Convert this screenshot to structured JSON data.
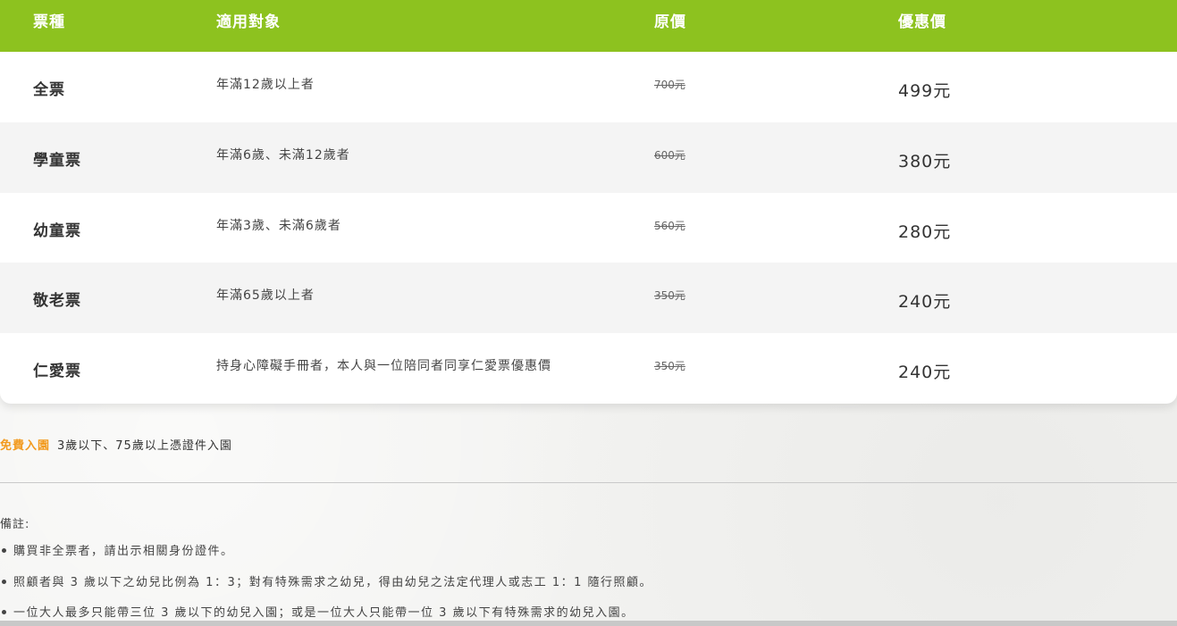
{
  "table": {
    "headers": [
      "票種",
      "適用對象",
      "原價",
      "優惠價"
    ],
    "rows": [
      {
        "name": "全票",
        "target": "年滿12歲以上者",
        "original": "700元",
        "sale": "499元"
      },
      {
        "name": "學童票",
        "target": "年滿6歲、未滿12歲者",
        "original": "600元",
        "sale": "380元"
      },
      {
        "name": "幼童票",
        "target": "年滿3歲、未滿6歲者",
        "original": "560元",
        "sale": "280元"
      },
      {
        "name": "敬老票",
        "target": "年滿65歲以上者",
        "original": "350元",
        "sale": "240元"
      },
      {
        "name": "仁愛票",
        "target": "持身心障礙手冊者，本人與一位陪同者同享仁愛票優惠價",
        "original": "350元",
        "sale": "240元"
      }
    ]
  },
  "free_entry": {
    "label": "免費入園",
    "text": "3歲以下、75歲以上憑證件入園"
  },
  "notes": {
    "title": "備註:",
    "items": [
      "購買非全票者，請出示相關身份證件。",
      "照顧者與 3 歲以下之幼兒比例為 1：3；對有特殊需求之幼兒，得由幼兒之法定代理人或志工 1：1 隨行照顧。",
      "一位大人最多只能帶三位 3 歲以下的幼兒入園；或是一位大人只能帶一位 3 歲以下有特殊需求的幼兒入園。"
    ]
  },
  "colors": {
    "header_green": "#8dc21f",
    "free_label_orange": "#f29a1e"
  }
}
